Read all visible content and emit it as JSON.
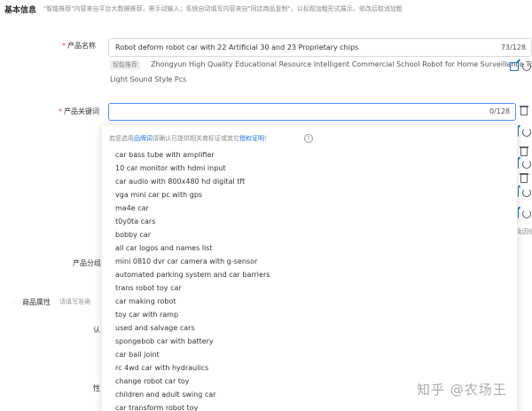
{
  "section": {
    "title": "基本信息",
    "note": "\"智能推荐\"内容来自平台大数据推荐，需手动输入；系统自动填写内容来自\"同店商品复制\"，以标题加粗形式展示，修改后取消加粗"
  },
  "product_name": {
    "label": "产品名称",
    "value": "Robot deform robot car with 22 Artificial 30   and 23 Proprietary chips",
    "count": "73/128"
  },
  "suggestion": {
    "badge": "智能推荐",
    "line1": "Zhongyun High Quality Educational Resource Intelligent Commercial School Robot for Home Surveillance Toy",
    "line2": "Light Sound Style Pcs"
  },
  "keyword": {
    "label": "产品关键词",
    "count": "0/128"
  },
  "dropdown": {
    "tip_before": "若您选用",
    "tip_link1": "品牌词",
    "tip_middle": "请确认已提供相关商标证或其它",
    "tip_link2": "授权证明",
    "tip_after": "！",
    "help": "?",
    "items": [
      "car bass tube with amplifier",
      "10 car monitor with hdmi input",
      "car audio with 800x480 hd digital tft",
      "vga mini car pc with gps",
      "ma4e car",
      "t0y0ta cars",
      "bobby car",
      "all car logos and names list",
      "mini 0810 dvr car camera with g-sensor",
      "automated parking system and car barriers",
      "trans robot toy car",
      "car making robot",
      "toy car with ramp",
      "used and salvage cars",
      "spongebob car with battery",
      "car ball joint",
      "rc 4wd car with hydraulics",
      "change robot car toy",
      "children and adult swing car",
      "car transform robot toy"
    ]
  },
  "background": {
    "group_label": "产品分组",
    "attr_title": "商品属性",
    "attr_note": "请填写准确",
    "row_a": "认",
    "row_b": "性",
    "side_text": "免因侵权"
  },
  "watermark": "知乎 @农场王"
}
